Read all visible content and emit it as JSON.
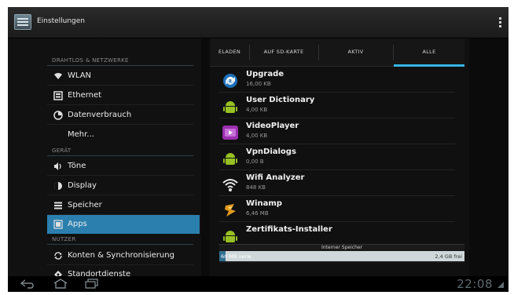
{
  "window": {
    "title": "Einstellungen"
  },
  "settings": {
    "sections": [
      {
        "header": "DRAHTLOS & NETZWERKE"
      },
      {
        "header": "GERÄT"
      },
      {
        "header": "NUTZER"
      }
    ],
    "items": [
      {
        "label": "WLAN",
        "icon": "wifi-icon"
      },
      {
        "label": "Ethernet",
        "icon": "ethernet-icon"
      },
      {
        "label": "Datenverbrauch",
        "icon": "data-usage-icon"
      },
      {
        "label": "Mehr...",
        "icon": ""
      },
      {
        "label": "Töne",
        "icon": "volume-icon"
      },
      {
        "label": "Display",
        "icon": "display-icon"
      },
      {
        "label": "Speicher",
        "icon": "storage-icon"
      },
      {
        "label": "Apps",
        "icon": "apps-icon",
        "selected": true
      },
      {
        "label": "Konten & Synchronisierung",
        "icon": "sync-icon"
      },
      {
        "label": "Standortdienste",
        "icon": "location-icon"
      }
    ]
  },
  "tabs": [
    {
      "label": "ELADEN"
    },
    {
      "label": "AUF SD-KARTE"
    },
    {
      "label": "AKTIV"
    },
    {
      "label": "ALLE",
      "active": true
    }
  ],
  "apps": [
    {
      "name": "Upgrade",
      "size": "16,00 KB",
      "icon": "upgrade-icon"
    },
    {
      "name": "User Dictionary",
      "size": "4,00 KB",
      "icon": "android-icon"
    },
    {
      "name": "VideoPlayer",
      "size": "4,00 KB",
      "icon": "video-player-icon"
    },
    {
      "name": "VpnDialogs",
      "size": "0,00 B",
      "icon": "android-icon"
    },
    {
      "name": "Wifi Analyzer",
      "size": "848 KB",
      "icon": "wifi-analyzer-icon"
    },
    {
      "name": "Winamp",
      "size": "6,46 MB",
      "icon": "winamp-icon"
    },
    {
      "name": "Zertifikats-Installer",
      "size": "",
      "icon": "android-icon"
    }
  ],
  "storage": {
    "title": "Interner Speicher",
    "used_label": "60 MB verw.",
    "free_label": "2,4 GB frei",
    "used_fraction": 0.025
  },
  "status": {
    "clock": "22:08"
  },
  "colors": {
    "accent": "#33b5e5",
    "selected": "#2b7fae"
  }
}
